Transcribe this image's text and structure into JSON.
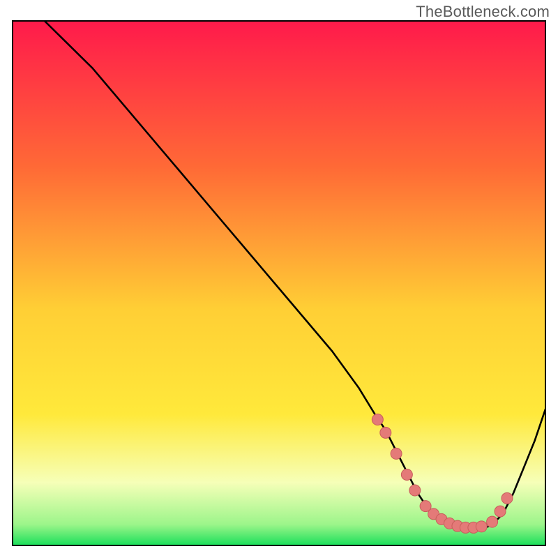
{
  "attribution": "TheBottleneck.com",
  "colors": {
    "gradient_top": "#ff1a4b",
    "gradient_mid_orange": "#ff9a2e",
    "gradient_yellow": "#ffe93b",
    "gradient_pale": "#f6ffb8",
    "gradient_green": "#1adf5a",
    "curve": "#000000",
    "marker_fill": "#e47a78",
    "marker_stroke": "#c85d5b",
    "border": "#000000"
  },
  "chart_data": {
    "type": "line",
    "title": "",
    "xlabel": "",
    "ylabel": "",
    "xlim": [
      0,
      100
    ],
    "ylim": [
      0,
      100
    ],
    "curve": {
      "x": [
        0,
        6,
        10,
        15,
        20,
        25,
        30,
        35,
        40,
        45,
        50,
        55,
        60,
        65,
        68,
        70,
        72,
        74,
        76,
        78,
        80,
        82,
        84,
        86,
        88,
        90,
        92,
        94,
        96,
        98,
        100
      ],
      "y": [
        103,
        100,
        96,
        91,
        85,
        79,
        73,
        67,
        61,
        55,
        49,
        43,
        37,
        30,
        25,
        22,
        18,
        14,
        10,
        7,
        5,
        4,
        3,
        3,
        3,
        4,
        6,
        10,
        15,
        20,
        26
      ]
    },
    "markers": {
      "x": [
        68.5,
        70.0,
        72.0,
        74.0,
        75.5,
        77.5,
        79.0,
        80.5,
        82.0,
        83.5,
        85.0,
        86.5,
        88.0,
        90.0,
        91.5,
        92.8
      ],
      "y": [
        24.0,
        21.5,
        17.5,
        13.5,
        10.5,
        7.5,
        6.0,
        5.0,
        4.2,
        3.7,
        3.4,
        3.4,
        3.6,
        4.5,
        6.5,
        9.0
      ]
    }
  }
}
